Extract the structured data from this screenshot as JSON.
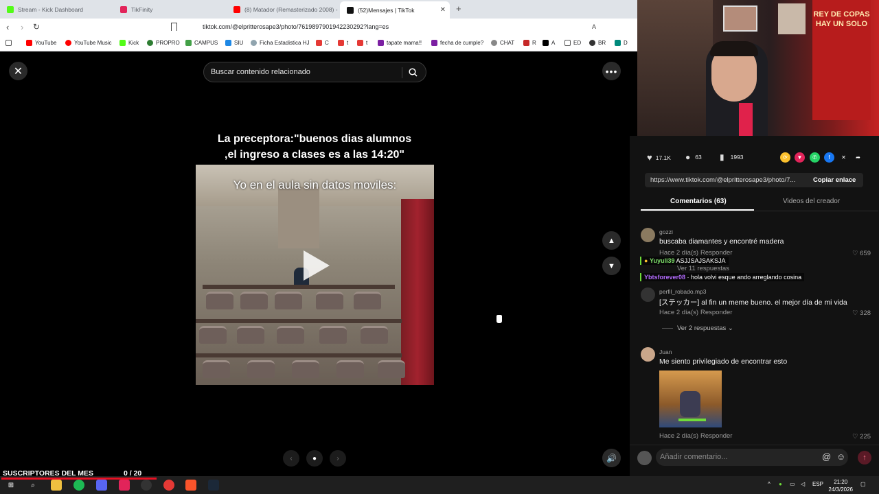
{
  "browser": {
    "tabs": [
      {
        "label": "Stream - Kick Dashboard",
        "color": "#53fc18"
      },
      {
        "label": "TikFinity",
        "color": "#e2245a"
      },
      {
        "label": "(8) Matador (Remasterizado 2008) - ",
        "color": "#ff0000"
      },
      {
        "label": "(52)Mensajes | TikTok",
        "color": "#111111",
        "active": true
      }
    ],
    "url": "tiktok.com/@elpritterosape3/photo/7619897901942230292?lang=es",
    "bookmarks": [
      "YouTube",
      "YouTube Music",
      "Kick",
      "PROPRO",
      "CAMPUS",
      "SIU",
      "Ficha Estadistica HJ",
      "C",
      "t",
      "t",
      "tapate mama!!",
      "fecha de cumple?",
      "CHAT",
      "R",
      "A",
      "ED",
      "BR",
      "D"
    ]
  },
  "viewer": {
    "search_placeholder": "Buscar contenido relacionado",
    "caption_line1": "La preceptora:\"buenos dias alumnos",
    "caption_line2": ",el ingreso a clases es a las 14:20\"",
    "photo_text": "Yo en el aula sin datos moviles:"
  },
  "stats": {
    "likes": "17.1K",
    "comments": "63",
    "saves": "1993"
  },
  "share": {
    "link": "https://www.tiktok.com/@elpritterosape3/photo/7...",
    "copy_label": "Copiar enlace"
  },
  "panel_tabs": {
    "comments": "Comentarios (63)",
    "creator": "Videos del creador"
  },
  "comments": [
    {
      "user": "gozzi",
      "text": "buscaba diamantes y encontré madera",
      "meta": "Hace 2 día(s)",
      "reply": "Responder",
      "likes": "659",
      "replies": "Ver 11 respuestas"
    },
    {
      "user": "perfil_robado.mp3",
      "text": "[ステッカー] al fin un meme bueno. el mejor día de mi vida",
      "meta": "Hace 2 día(s)",
      "reply": "Responder",
      "likes": "328",
      "replies": "Ver 2 respuestas"
    },
    {
      "user": "Juan",
      "text": "Me siento privilegiado de encontrar esto",
      "meta": "Hace 2 día(s)",
      "reply": "Responder",
      "likes": "225"
    }
  ],
  "chat_overlay": [
    {
      "user": "Yuyuli39",
      "message": "ASJJSAJSAKSJA",
      "color": "#7ee06a"
    },
    {
      "user": "Ybtsforever08",
      "message": "hola volvi esque ando arreglando cosina",
      "color": "#b46cff"
    }
  ],
  "comment_placeholder": "Añadir comentario...",
  "overlay": {
    "subs_label": "SUSCRIPTORES DEL MES",
    "subs_count": "0  / 20"
  },
  "taskbar": {
    "lang": "ESP",
    "time": "21:20",
    "date": "24/3/2026"
  }
}
